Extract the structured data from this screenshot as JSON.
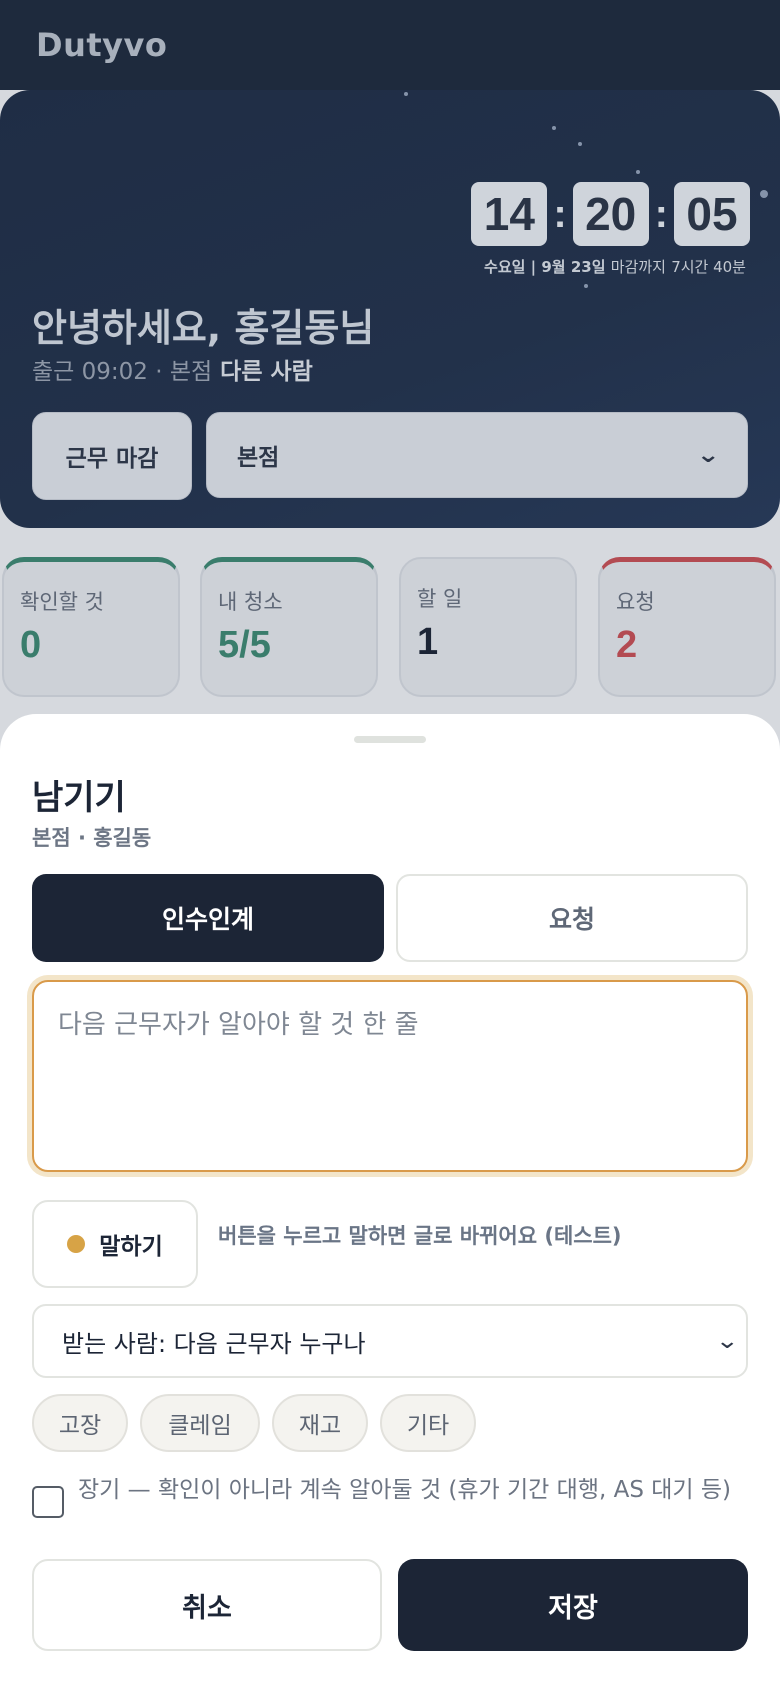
{
  "app": {
    "title": "Dutyvo"
  },
  "hero": {
    "clock": {
      "hours": "14",
      "minutes": "20",
      "seconds": "05"
    },
    "date": "수요일 | 9월 23일",
    "deadline_prefix": "마감까지",
    "deadline_remaining": "7시간 40분",
    "greeting": "안녕하세요, 홍길동님",
    "checkin": "출근 09:02 · 본점",
    "other_person": "다른 사람",
    "end_shift_label": "근무 마감",
    "branch_select": "본점"
  },
  "stats": [
    {
      "label": "확인할 것",
      "value": "0",
      "color": "#3a7d6c"
    },
    {
      "label": "내 청소",
      "value": "5/5",
      "color": "#3a7d6c"
    },
    {
      "label": "할 일",
      "value": "1",
      "color": "#1c2536"
    },
    {
      "label": "요청",
      "value": "2",
      "color": "#b34b52"
    }
  ],
  "sheet": {
    "title": "남기기",
    "subtitle": "본점 · 홍길동",
    "tabs": [
      {
        "label": "인수인계",
        "active": true
      },
      {
        "label": "요청",
        "active": false
      }
    ],
    "note_placeholder": "다음 근무자가 알아야 할 것 한 줄",
    "note_value": "",
    "mic_label": "말하기",
    "mic_hint": "버튼을 누르고 말하면 글로 바뀌어요 (테스트)",
    "recipient_select": "받는 사람: 다음 근무자 누구나",
    "tags": [
      "고장",
      "클레임",
      "재고",
      "기타"
    ],
    "long_term_label": "장기 — 확인이 아니라 계속 알아둘 것 (휴가 기간 대행, AS 대기 등)",
    "cancel_label": "취소",
    "save_label": "저장"
  },
  "colors": {
    "navy": "#1c2536",
    "accent_gold": "#d7a346",
    "focus_border": "#d99a4a"
  }
}
